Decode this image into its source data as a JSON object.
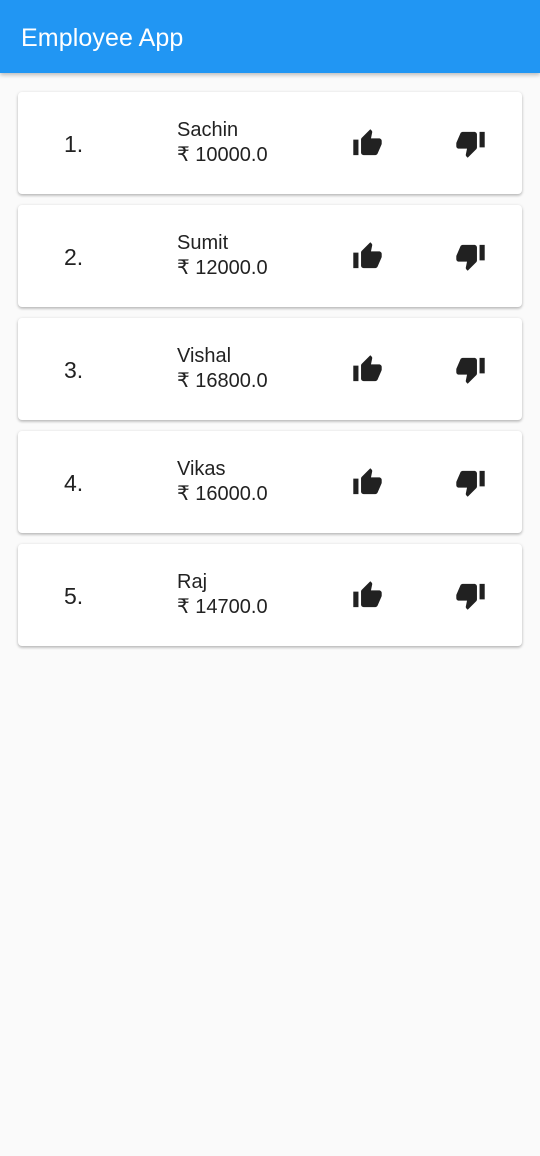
{
  "app_bar": {
    "title": "Employee App",
    "color": "#2196f3"
  },
  "currency_symbol": "₹",
  "employees": [
    {
      "index": "1.",
      "name": "Sachin",
      "salary": "10000.0"
    },
    {
      "index": "2.",
      "name": "Sumit",
      "salary": "12000.0"
    },
    {
      "index": "3.",
      "name": "Vishal",
      "salary": "16800.0"
    },
    {
      "index": "4.",
      "name": "Vikas",
      "salary": "16000.0"
    },
    {
      "index": "5.",
      "name": "Raj",
      "salary": "14700.0"
    }
  ],
  "icons": {
    "like": "thumb-up-icon",
    "dislike": "thumb-down-icon"
  }
}
